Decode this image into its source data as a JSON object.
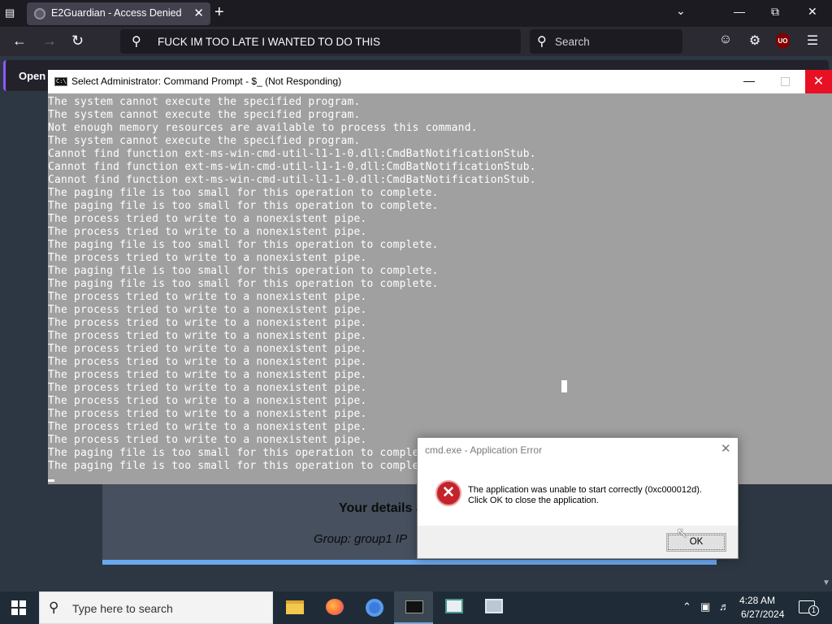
{
  "browser": {
    "tab_title": "E2Guardian - Access Denied",
    "url_text": "FUCK IM TOO LATE I WANTED TO DO THIS",
    "search_placeholder": "Search",
    "ublock_label": "UO"
  },
  "page": {
    "notification_button": "Open F",
    "details_title": "Your details a",
    "details_group": "Group: group1   IP"
  },
  "cmd": {
    "title": "Select Administrator: Command Prompt - $_ (Not Responding)",
    "lines": [
      "The system cannot execute the specified program.",
      "The system cannot execute the specified program.",
      "Not enough memory resources are available to process this command.",
      "The system cannot execute the specified program.",
      "Cannot find function ext-ms-win-cmd-util-l1-1-0.dll:CmdBatNotificationStub.",
      "Cannot find function ext-ms-win-cmd-util-l1-1-0.dll:CmdBatNotificationStub.",
      "Cannot find function ext-ms-win-cmd-util-l1-1-0.dll:CmdBatNotificationStub.",
      "The paging file is too small for this operation to complete.",
      "The paging file is too small for this operation to complete.",
      "The process tried to write to a nonexistent pipe.",
      "The process tried to write to a nonexistent pipe.",
      "The paging file is too small for this operation to complete.",
      "The process tried to write to a nonexistent pipe.",
      "The paging file is too small for this operation to complete.",
      "The paging file is too small for this operation to complete.",
      "The process tried to write to a nonexistent pipe.",
      "The process tried to write to a nonexistent pipe.",
      "The process tried to write to a nonexistent pipe.",
      "The process tried to write to a nonexistent pipe.",
      "The process tried to write to a nonexistent pipe.",
      "The process tried to write to a nonexistent pipe.",
      "The process tried to write to a nonexistent pipe.",
      "The process tried to write to a nonexistent pipe.",
      "The process tried to write to a nonexistent pipe.",
      "The process tried to write to a nonexistent pipe.",
      "The process tried to write to a nonexistent pipe.",
      "The process tried to write to a nonexistent pipe.",
      "The paging file is too small for this operation to comple",
      "The paging file is too small for this operation to comple"
    ]
  },
  "dialog": {
    "title": "cmd.exe - Application Error",
    "message_line1": "The application was unable to start correctly (0xc000012d).",
    "message_line2": "Click OK to close the application.",
    "ok_label": "OK"
  },
  "taskbar": {
    "search_placeholder": "Type here to search",
    "time": "4:28 AM",
    "date": "6/27/2024",
    "notification_count": "1"
  }
}
